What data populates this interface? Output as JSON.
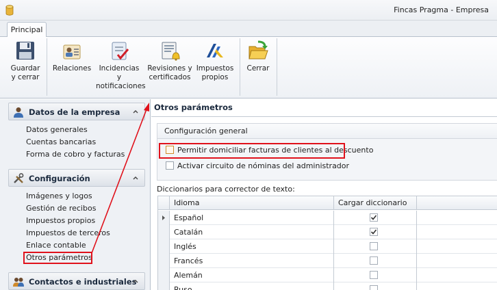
{
  "window": {
    "title": "Fincas Pragma - Empresa"
  },
  "ribbon": {
    "tab": "Principal",
    "buttons": [
      {
        "line1": "Guardar",
        "line2": "y cerrar",
        "icon": "floppy-disk-icon"
      },
      {
        "line1": "Relaciones",
        "line2": "",
        "icon": "contacts-card-icon"
      },
      {
        "line1": "Incidencias y",
        "line2": "notificaciones",
        "icon": "checklist-clipboard-icon"
      },
      {
        "line1": "Revisiones y",
        "line2": "certificados",
        "icon": "certificate-bell-icon"
      },
      {
        "line1": "Impuestos",
        "line2": "propios",
        "icon": "tax-agency-logo-icon"
      },
      {
        "line1": "Cerrar",
        "line2": "",
        "icon": "open-folder-arrow-icon"
      }
    ]
  },
  "sidebar": {
    "groups": [
      {
        "title": "Datos de la empresa",
        "items": [
          "Datos generales",
          "Cuentas bancarias",
          "Forma de cobro y facturas"
        ]
      },
      {
        "title": "Configuración",
        "items": [
          "Imágenes y logos",
          "Gestión de recibos",
          "Impuestos propios",
          "Impuestos de terceros",
          "Enlace contable",
          "Otros parámetros"
        ]
      },
      {
        "title": "Contactos e industriales",
        "items": []
      }
    ],
    "selected": "Otros parámetros"
  },
  "main": {
    "title": "Otros parámetros",
    "config_group": {
      "title": "Configuración general",
      "options": [
        {
          "label": "Permitir domiciliar facturas de clientes al descuento",
          "checked": false
        },
        {
          "label": "Activar circuito de nóminas del administrador",
          "checked": false
        }
      ]
    },
    "dict_label": "Diccionarios para corrector de texto:",
    "table": {
      "columns": [
        "Idioma",
        "Cargar diccionario"
      ],
      "rows": [
        {
          "idioma": "Español",
          "cargar": true,
          "current": true
        },
        {
          "idioma": "Catalán",
          "cargar": true
        },
        {
          "idioma": "Inglés",
          "cargar": false
        },
        {
          "idioma": "Francés",
          "cargar": false
        },
        {
          "idioma": "Alemán",
          "cargar": false
        },
        {
          "idioma": "Ruso",
          "cargar": false
        }
      ]
    }
  },
  "colors": {
    "highlight": "#e0111b",
    "accent": "#1b2a3e"
  }
}
